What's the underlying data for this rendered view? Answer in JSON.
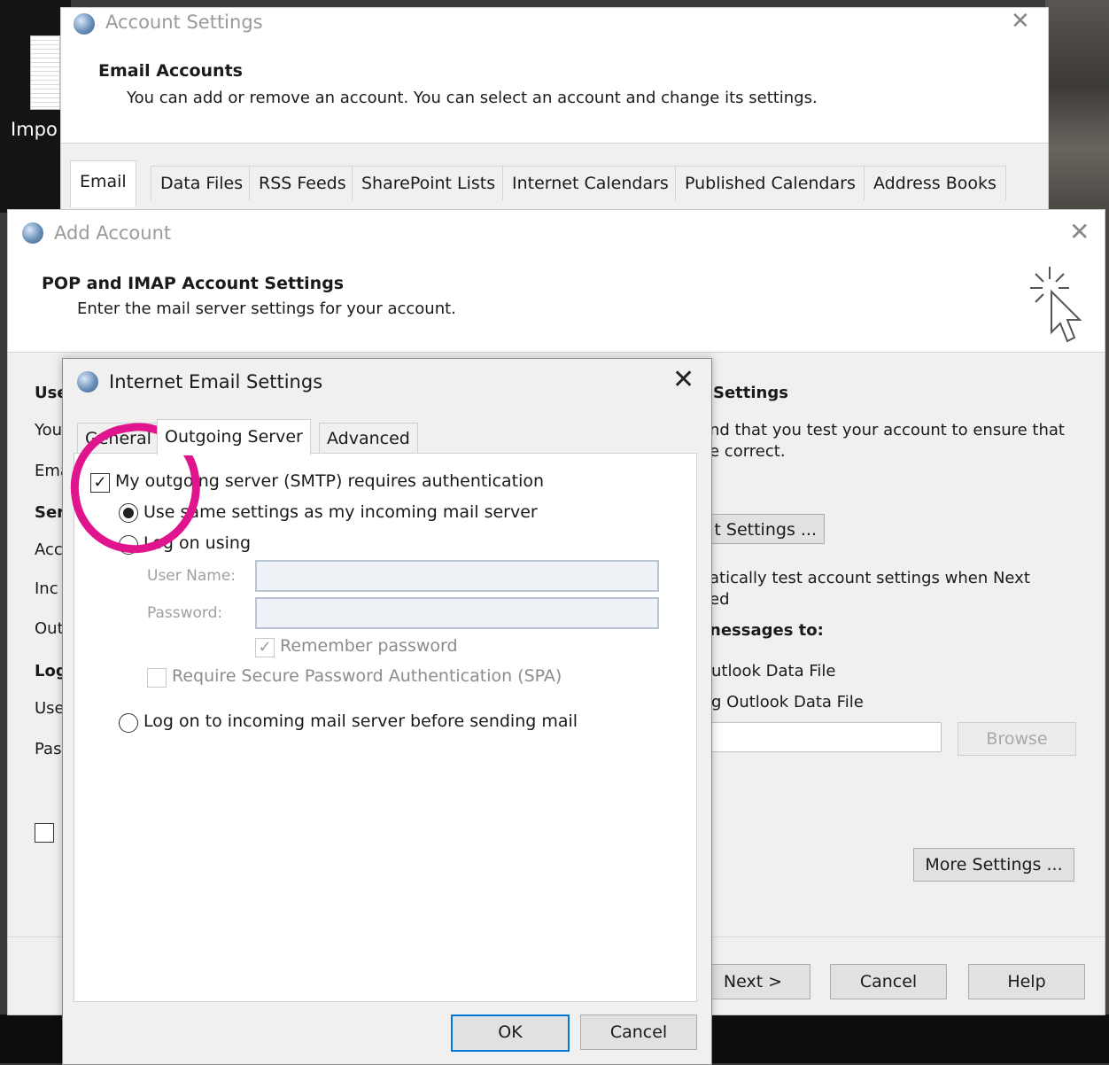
{
  "desktop": {
    "label": "Impo"
  },
  "account_settings": {
    "title": "Account Settings",
    "heading": "Email Accounts",
    "description": "You can add or remove an account. You can select an account and change its settings.",
    "tabs": [
      "Email",
      "Data Files",
      "RSS Feeds",
      "SharePoint Lists",
      "Internet Calendars",
      "Published Calendars",
      "Address Books"
    ],
    "close": "✕"
  },
  "add_account": {
    "title": "Add Account",
    "heading": "POP and IMAP Account Settings",
    "description": "Enter the mail server settings for your account.",
    "close": "✕",
    "left_labels": [
      "Use",
      "You",
      "Ema",
      "Ser",
      "Acc",
      "Inc",
      "Out",
      "Log",
      "Use",
      "Pas"
    ],
    "right": {
      "settings_heading": "Settings",
      "test_text_1": "nd that you test your account to ensure that",
      "test_text_2": "e correct.",
      "test_button": "t Settings ...",
      "auto_test_1": "atically test account settings when Next",
      "auto_test_2": "ed",
      "deliver_heading": "nessages to:",
      "opt_new": "utlook Data File",
      "opt_existing": "g Outlook Data File",
      "browse": "Browse",
      "more_settings": "More Settings ..."
    },
    "buttons": {
      "next": "Next >",
      "cancel": "Cancel",
      "help": "Help"
    }
  },
  "ies": {
    "title": "Internet Email Settings",
    "close": "✕",
    "tabs": [
      "General",
      "Outgoing Server",
      "Advanced"
    ],
    "active_tab": "Outgoing Server",
    "requires_auth": {
      "label": "My outgoing server (SMTP) requires authentication",
      "checked": true
    },
    "use_same": {
      "label": "Use same settings as my incoming mail server",
      "selected": true
    },
    "log_on_using": {
      "label": "Log on using",
      "selected": false
    },
    "user_name_label": "User Name:",
    "password_label": "Password:",
    "remember_password": {
      "label": "Remember password",
      "checked": true
    },
    "spa": {
      "label": "Require Secure Password Authentication (SPA)",
      "checked": false
    },
    "log_on_incoming": {
      "label": "Log on to incoming mail server before sending mail",
      "selected": false
    },
    "buttons": {
      "ok": "OK",
      "cancel": "Cancel"
    }
  },
  "annotation_color": "#e0148c"
}
